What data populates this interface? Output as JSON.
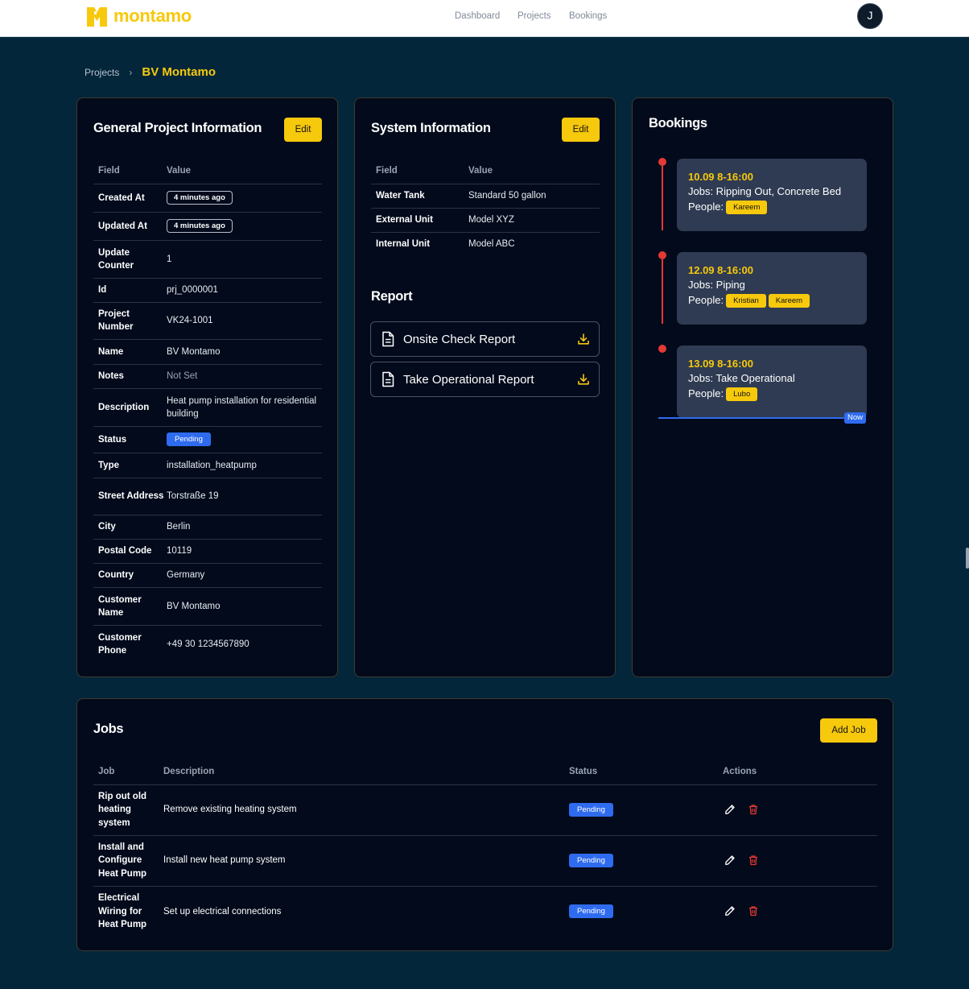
{
  "brand": {
    "name": "montamo",
    "accent": "#f7c90c"
  },
  "nav": {
    "items": [
      "Dashboard",
      "Projects",
      "Bookings"
    ]
  },
  "user": {
    "initial": "J"
  },
  "breadcrumb": {
    "parent": "Projects",
    "separator": "›",
    "current": "BV Montamo"
  },
  "general": {
    "title": "General Project Information",
    "edit_label": "Edit",
    "headers": {
      "field": "Field",
      "value": "Value"
    },
    "rows": [
      {
        "field": "Created At",
        "value": "4 minutes ago"
      },
      {
        "field": "Updated At",
        "value": "4 minutes ago"
      },
      {
        "field": "Update Counter",
        "value": "1"
      },
      {
        "field": "Id",
        "value": "prj_0000001"
      },
      {
        "field": "Project Number",
        "value": "VK24-1001"
      },
      {
        "field": "Name",
        "value": "BV Montamo"
      },
      {
        "field": "Notes",
        "value": "Not Set"
      },
      {
        "field": "Description",
        "value": "Heat pump installation for residential building"
      },
      {
        "field": "Status",
        "value": "Pending"
      },
      {
        "field": "Type",
        "value": "installation_heatpump"
      },
      {
        "field": "Street Address",
        "value": "Torstraße 19"
      },
      {
        "field": "City",
        "value": "Berlin"
      },
      {
        "field": "Postal Code",
        "value": "10119"
      },
      {
        "field": "Country",
        "value": "Germany"
      },
      {
        "field": "Customer Name",
        "value": "BV Montamo"
      },
      {
        "field": "Customer Phone",
        "value": "+49 30 1234567890"
      }
    ]
  },
  "system": {
    "title": "System Information",
    "edit_label": "Edit",
    "headers": {
      "field": "Field",
      "value": "Value"
    },
    "rows": [
      {
        "field": "Water Tank",
        "value": "Standard 50 gallon"
      },
      {
        "field": "External Unit",
        "value": "Model XYZ"
      },
      {
        "field": "Internal Unit",
        "value": "Model ABC"
      }
    ]
  },
  "report": {
    "title": "Report",
    "items": [
      {
        "label": "Onsite Check Report",
        "icon": "document-icon",
        "action_icon": "download-icon"
      },
      {
        "label": "Take Operational Report",
        "icon": "document-icon",
        "action_icon": "download-icon"
      }
    ]
  },
  "bookings": {
    "title": "Bookings",
    "now_label": "Now",
    "people_prefix": "People:",
    "items": [
      {
        "time": "10.09 8-16:00",
        "jobs": "Jobs: Ripping Out, Concrete Bed",
        "people": [
          "Kareem"
        ]
      },
      {
        "time": "12.09 8-16:00",
        "jobs": "Jobs: Piping",
        "people": [
          "Kristian",
          "Kareem"
        ]
      },
      {
        "time": "13.09 8-16:00",
        "jobs": "Jobs: Take Operational",
        "people": [
          "Lubo"
        ]
      }
    ]
  },
  "jobs": {
    "title": "Jobs",
    "add_label": "Add Job",
    "headers": {
      "job": "Job",
      "description": "Description",
      "status": "Status",
      "actions": "Actions"
    },
    "rows": [
      {
        "job": "Rip out old heating system",
        "description": "Remove existing heating system",
        "status": "Pending"
      },
      {
        "job": "Install and Configure Heat Pump",
        "description": "Install new heat pump system",
        "status": "Pending"
      },
      {
        "job": "Electrical Wiring for Heat Pump",
        "description": "Set up electrical connections",
        "status": "Pending"
      }
    ]
  },
  "colors": {
    "page_bg": "#03263a",
    "card_bg": "#020a1b",
    "accent_yellow": "#f7c90c",
    "status_blue": "#2f6bef",
    "timeline_red": "#e53935",
    "booking_card": "#2f3b52"
  }
}
